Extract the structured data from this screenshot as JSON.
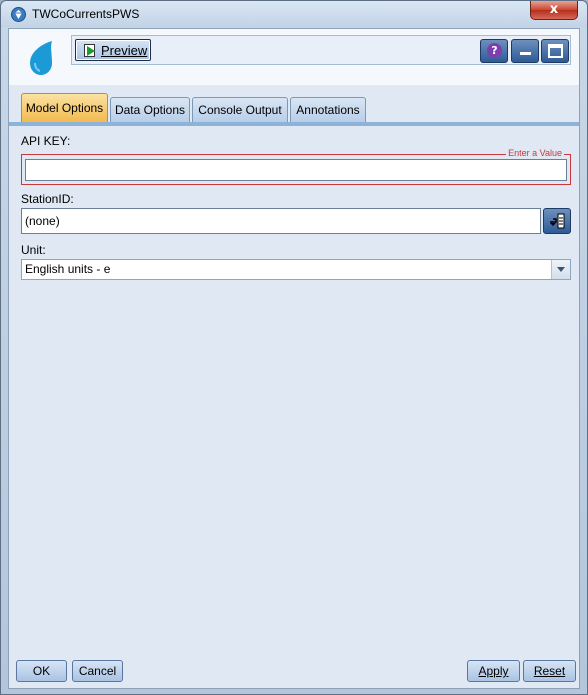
{
  "window": {
    "title": "TWCoCurrentsPWS",
    "close_label": "x"
  },
  "toolbar": {
    "preview_label": "Preview",
    "help_label": "?"
  },
  "tabs": [
    {
      "label": "Model Options",
      "active": true
    },
    {
      "label": "Data Options",
      "active": false
    },
    {
      "label": "Console Output",
      "active": false
    },
    {
      "label": "Annotations",
      "active": false
    }
  ],
  "form": {
    "api_key": {
      "label": "API KEY:",
      "value": "",
      "hint": "Enter a Value"
    },
    "station_id": {
      "label": "StationID:",
      "value": "(none)"
    },
    "unit": {
      "label": "Unit:",
      "value": "English units - e"
    }
  },
  "buttons": {
    "ok": "OK",
    "cancel": "Cancel",
    "apply": "Apply",
    "reset": "Reset"
  },
  "colors": {
    "accent_tab": "#f2b84b",
    "error_border": "#c8383d",
    "drop_icon": "#1c9ad6"
  }
}
